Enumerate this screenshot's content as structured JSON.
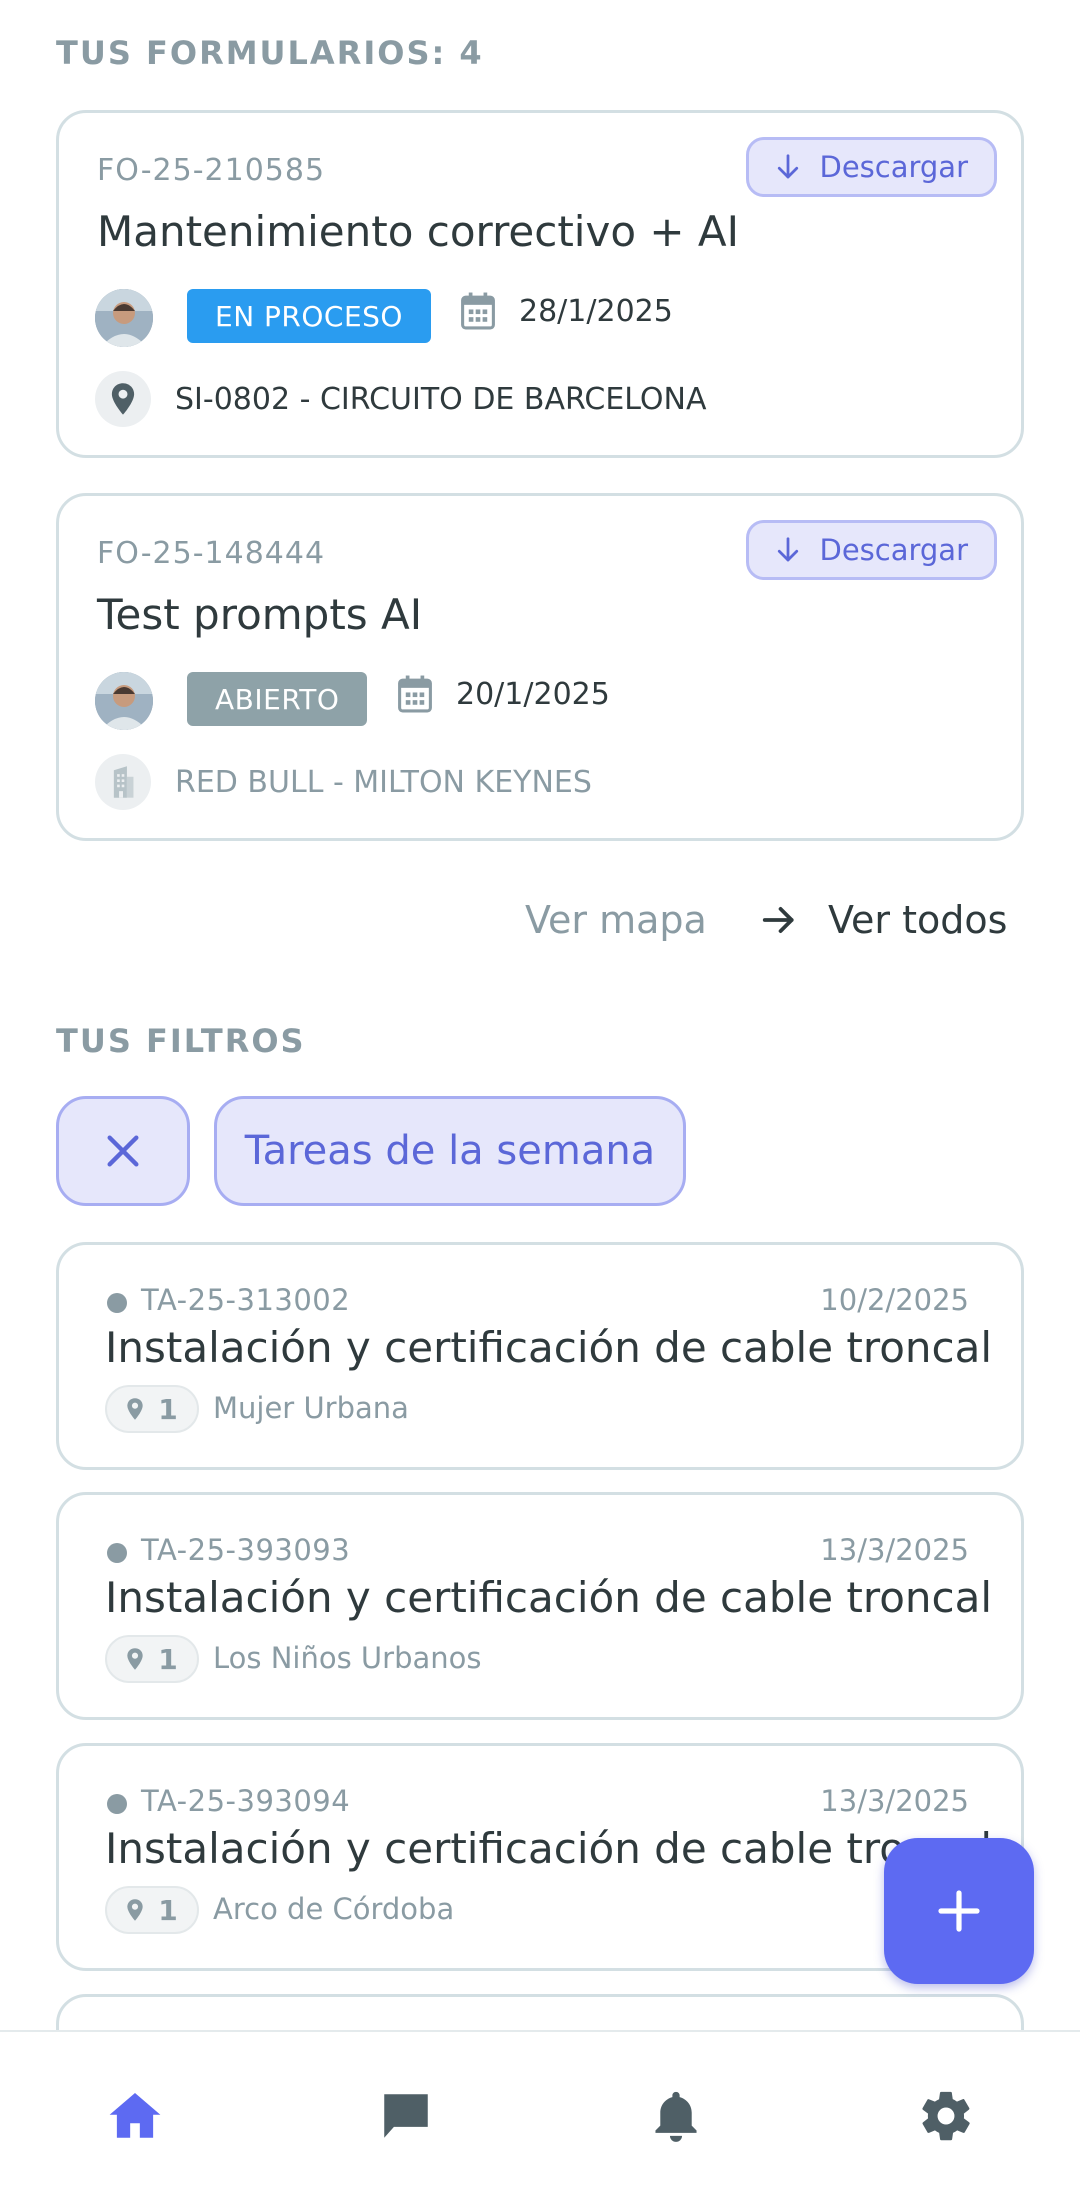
{
  "forms_section": {
    "title": "TUS FORMULARIOS: 4",
    "forms": [
      {
        "code": "FO-25-210585",
        "title": "Mantenimiento correctivo + AI",
        "download_label": "Descargar",
        "status": "EN PROCESO",
        "status_color": "#2a9cf0",
        "date": "28/1/2025",
        "location": "SI-0802 - CIRCUITO DE BARCELONA",
        "location_icon": "map-pin-icon"
      },
      {
        "code": "FO-25-148444",
        "title": "Test prompts AI",
        "download_label": "Descargar",
        "status": "ABIERTO",
        "status_color": "#8ea2a8",
        "date": "20/1/2025",
        "location": "RED BULL - MILTON KEYNES",
        "location_icon": "building-icon"
      }
    ],
    "view_map_label": "Ver mapa",
    "view_all_label": "Ver todos"
  },
  "filters_section": {
    "title": "TUS FILTROS",
    "active_filter": "Tareas de la semana"
  },
  "tasks": [
    {
      "code": "TA-25-313002",
      "date": "10/2/2025",
      "title": "Instalación y certificación de cable troncal",
      "count": "1",
      "place": "Mujer Urbana"
    },
    {
      "code": "TA-25-393093",
      "date": "13/3/2025",
      "title": "Instalación y certificación de cable troncal",
      "count": "1",
      "place": "Los Niños Urbanos"
    },
    {
      "code": "TA-25-393094",
      "date": "13/3/2025",
      "title": "Instalación y certificación de cable troncal",
      "count": "1",
      "place": "Arco de Córdoba"
    }
  ],
  "nav": {
    "items": [
      "home-icon",
      "chat-icon",
      "bell-icon",
      "gear-icon"
    ],
    "active": "home-icon",
    "active_color": "#5d6af2",
    "inactive_color": "#4f5f66"
  },
  "colors": {
    "accent": "#5d6af2",
    "muted_text": "#8a9ba3",
    "card_border": "#d3dfe3"
  }
}
